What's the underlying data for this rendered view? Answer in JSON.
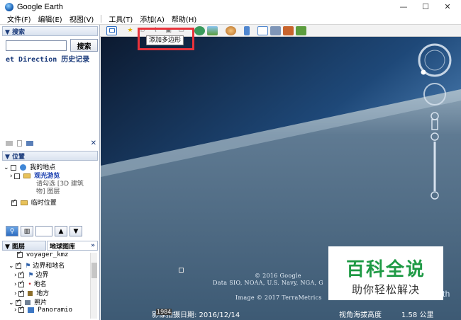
{
  "window": {
    "title": "Google Earth",
    "minimize": "—",
    "maximize": "☐",
    "close": "✕"
  },
  "menu": [
    "文件(F)",
    "编辑(E)",
    "视图(V)",
    "工具(T)",
    "添加(A)",
    "帮助(H)"
  ],
  "search": {
    "header": "▼ 搜索",
    "button": "搜索",
    "input_value": "",
    "tabs": "et Direction  历史记录"
  },
  "panel_tools": {
    "close": "✕"
  },
  "places": {
    "header": "▼ 位置",
    "my_places": "我的地点",
    "tour": "观光游览",
    "tour_hint_1": "请勾选 [3D 建筑",
    "tour_hint_2": "物] 图层",
    "temp": "临时位置"
  },
  "layers": {
    "tab_layers": "▼ 图层",
    "tab_gallery": "地球图库",
    "expand": "»",
    "items": [
      "voyager_kmz",
      "边界和地名",
      "边界",
      "地名",
      "地方",
      "照片",
      "Panoramio"
    ]
  },
  "toolbar": {
    "tooltip": "添加多边形"
  },
  "map": {
    "credits": [
      "© 2016 Google",
      "Data SIO, NOAA, U.S. Navy, NGA, G",
      "Image © 2017 TerraMetrics"
    ],
    "corner": "th",
    "year": "1984",
    "imagery_date": "影像拍摄日期: 2016/12/14",
    "altitude_label": "视角海拔高度",
    "altitude_value": "1.58 公里"
  },
  "watermark": {
    "title": "百科全说",
    "subtitle": "助你轻松解决"
  },
  "colors": {
    "accent_red": "#e8333b",
    "watermark_green": "#1f9a45",
    "ocean": "#2a5e96",
    "sky_top": "#0c1a30"
  }
}
